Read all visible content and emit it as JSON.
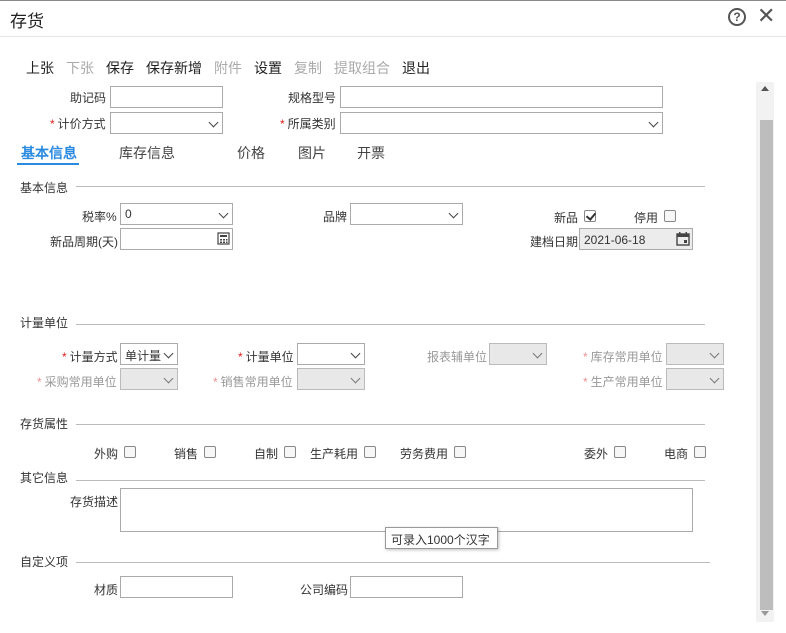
{
  "window": {
    "title": "存货"
  },
  "toolbar": {
    "prev": "上张",
    "next": "下张",
    "save": "保存",
    "save_new": "保存新增",
    "attachment": "附件",
    "settings": "设置",
    "copy": "复制",
    "extract_combo": "提取组合",
    "exit": "退出"
  },
  "header_fields": {
    "mnemonic_label": "助记码",
    "spec_label": "规格型号",
    "pricing_label": "计价方式",
    "category_label": "所属类别"
  },
  "tabs": [
    "基本信息",
    "库存信息",
    "价格",
    "图片",
    "开票"
  ],
  "basic": {
    "section": "基本信息",
    "tax_label": "税率%",
    "tax_value": "0",
    "brand_label": "品牌",
    "new_label": "新品",
    "new_checked": true,
    "disabled_label": "停用",
    "disabled_checked": false,
    "new_period_label": "新品周期(天)",
    "created_label": "建档日期",
    "created_value": "2021-06-18"
  },
  "units": {
    "section": "计量单位",
    "method_label": "计量方式",
    "method_value": "单计量",
    "unit_label": "计量单位",
    "report_aux_label": "报表辅单位",
    "stock_common_label": "库存常用单位",
    "purchase_common_label": "采购常用单位",
    "sales_common_label": "销售常用单位",
    "production_common_label": "生产常用单位"
  },
  "attrs": {
    "section": "存货属性",
    "items": [
      "外购",
      "销售",
      "自制",
      "生产耗用",
      "劳务费用",
      "委外",
      "电商"
    ]
  },
  "other": {
    "section": "其它信息",
    "desc_label": "存货描述",
    "tooltip": "可录入1000个汉字"
  },
  "custom": {
    "section": "自定义项",
    "material_label": "材质",
    "company_code_label": "公司编码"
  },
  "colors": {
    "accent": "#2a8ae0",
    "required": "#e02020"
  }
}
